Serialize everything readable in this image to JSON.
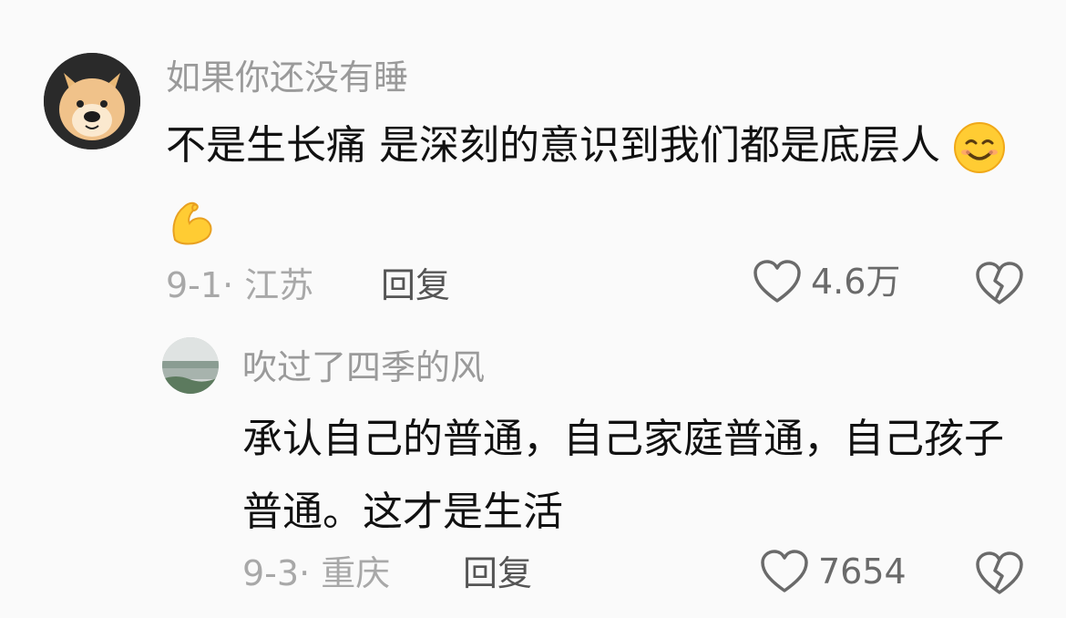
{
  "comment": {
    "username": "如果你还没有睡",
    "text": "不是生长痛 是深刻的意识到我们都是底层人",
    "emojis": [
      "smiling-face-icon",
      "flexed-biceps-icon"
    ],
    "date_location": "9-1· 江苏",
    "reply_label": "回复",
    "like_count": "4.6万"
  },
  "reply": {
    "username": "吹过了四季的风",
    "text": "承认自己的普通，自己家庭普通，自己孩子普通。这才是生活",
    "date_location": "9-3· 重庆",
    "reply_label": "回复",
    "like_count": "7654"
  }
}
